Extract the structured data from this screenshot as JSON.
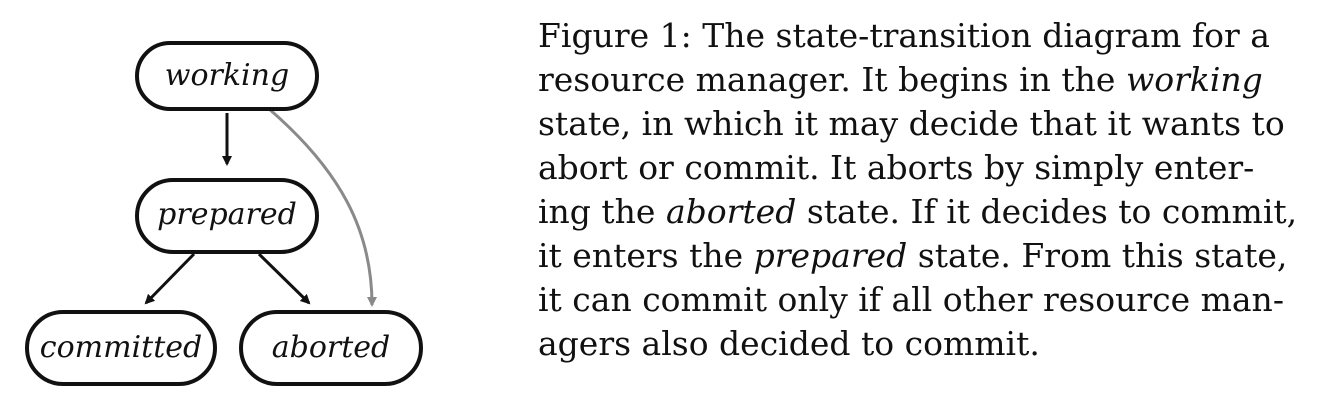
{
  "diagram": {
    "nodes": {
      "working": "working",
      "prepared": "prepared",
      "committed": "committed",
      "aborted": "aborted"
    },
    "colors": {
      "edge": "#111111",
      "edge_gray": "#8a8a8a"
    }
  },
  "caption": {
    "lines": [
      {
        "a": "Figure 1: The state-transition diagram for a",
        "em": "",
        "b": ""
      },
      {
        "a": "resource manager.  It begins in the ",
        "em": "working",
        "b": ""
      },
      {
        "a": "state, in which it may decide that it wants to",
        "em": "",
        "b": ""
      },
      {
        "a": "abort or commit.  It aborts by simply enter-",
        "em": "",
        "b": ""
      },
      {
        "a": "ing the ",
        "em": "aborted",
        "b": " state. If it decides to commit,"
      },
      {
        "a": "it enters the ",
        "em": "prepared",
        "b": " state. From this state,"
      },
      {
        "a": "it can commit only if all other resource man-",
        "em": "",
        "b": ""
      },
      {
        "a": "agers also decided to commit.",
        "em": "",
        "b": ""
      }
    ]
  }
}
